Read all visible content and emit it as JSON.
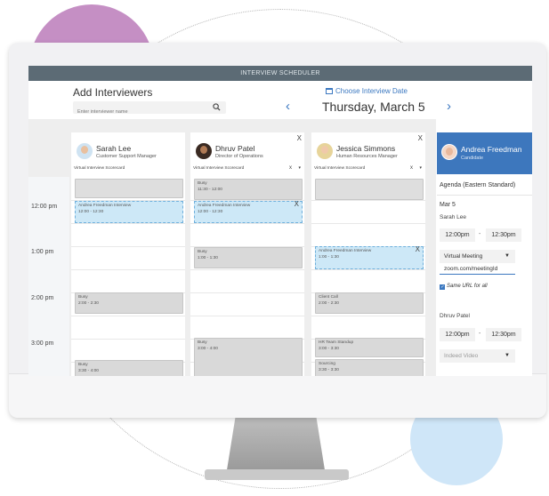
{
  "titlebar": "INTERVIEW SCHEDULER",
  "add_interviewers": {
    "title": "Add Interviewers",
    "placeholder": "Enter interviewer name"
  },
  "date_nav": {
    "choose_label": "Choose Interview Date",
    "current_date": "Thursday, March 5",
    "prev": "‹",
    "next": "›"
  },
  "time_labels": [
    "12:00 pm",
    "1:00 pm",
    "2:00 pm",
    "3:00 pm"
  ],
  "interviewers": [
    {
      "name": "Sarah Lee",
      "role": "Customer Support Manager",
      "scorecard": "Virtual Interview Scorecard",
      "events": [
        {
          "kind": "interview",
          "title": "Andrea Freedman Interview",
          "time": "12:00 - 12:30"
        },
        {
          "kind": "busy",
          "title": "Busy",
          "time": "2:00 - 2:30"
        },
        {
          "kind": "busy",
          "title": "Busy",
          "time": "3:30 - 4:00"
        }
      ]
    },
    {
      "name": "Dhruv Patel",
      "role": "Director of Operations",
      "scorecard": "Virtual Interview Scorecard",
      "scorecard_remove": "x",
      "close": "X",
      "events": [
        {
          "kind": "busy",
          "title": "Busy",
          "time": "11:30 - 12:00"
        },
        {
          "kind": "interview",
          "title": "Andrea Freedman Interview",
          "time": "12:00 - 12:30",
          "remove": "X"
        },
        {
          "kind": "busy",
          "title": "Busy",
          "time": "1:00 - 1:30"
        },
        {
          "kind": "busy",
          "title": "Busy",
          "time": "3:00 - 4:00"
        }
      ]
    },
    {
      "name": "Jessica Simmons",
      "role": "Human Resources Manager",
      "scorecard": "Virtual Interview Scorecard",
      "scorecard_remove": "x",
      "close": "X",
      "events": [
        {
          "kind": "interview",
          "title": "Andrea Freedman Interview",
          "time": "1:00 - 1:30",
          "remove": "X"
        },
        {
          "kind": "busy",
          "title": "Client Call",
          "time": "2:00 - 2:30"
        },
        {
          "kind": "busy",
          "title": "HR Team Standup",
          "time": "3:00 - 3:30"
        },
        {
          "kind": "busy",
          "title": "Sourcing",
          "time": "3:30 - 3:30"
        }
      ]
    }
  ],
  "candidate_panel": {
    "name": "Andrea Freedman",
    "role": "Candidate",
    "agenda_label": "Agenda (Eastern Standard)",
    "date": "Mar 5",
    "entries": [
      {
        "person": "Sarah Lee",
        "start": "12:00pm",
        "end": "12:30pm",
        "dash": "-",
        "location": "Virtual Meeting",
        "url": "zoom.com/meetingId",
        "same_url": "Same URL for all"
      },
      {
        "person": "Dhruv Patel",
        "start": "12:00pm",
        "end": "12:30pm",
        "dash": "-",
        "location": "Indeed Video"
      }
    ]
  },
  "colors": {
    "accent": "#3b78c0",
    "titlebar": "#5c6b75",
    "interview_fill": "#cde8f7",
    "busy_fill": "#d9d9d9"
  }
}
